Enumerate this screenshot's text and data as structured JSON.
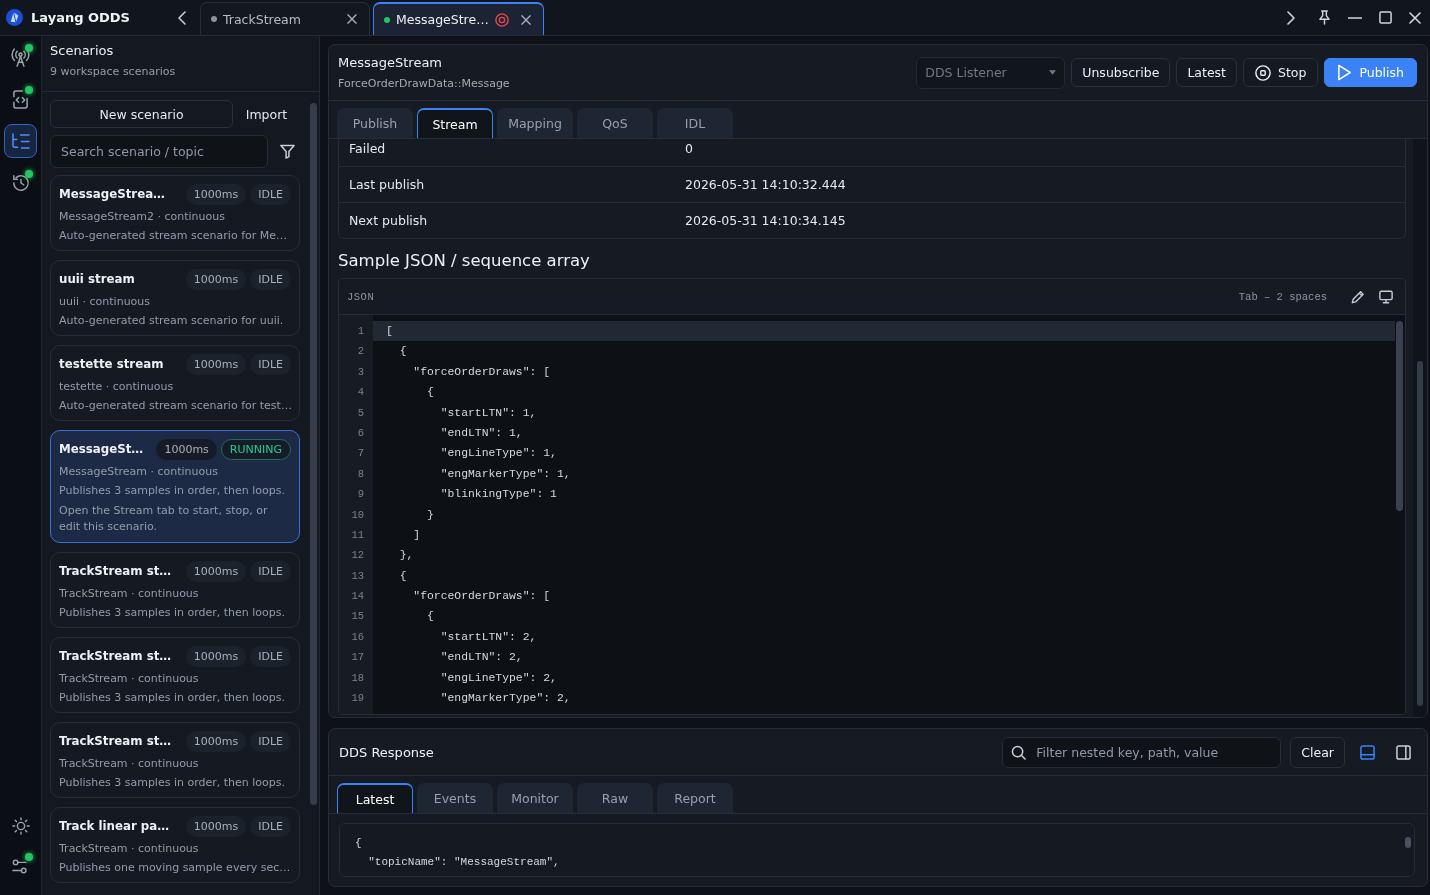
{
  "titlebar": {
    "app_name": "Layang ODDS",
    "tabs": [
      {
        "label": "TrackStream",
        "color": "#8b93a1",
        "running": false,
        "selected": false
      },
      {
        "label": "MessageStre…",
        "color": "#22c55e",
        "running": true,
        "selected": true
      }
    ]
  },
  "rail": {
    "top": [
      {
        "kind": "antenna",
        "selected": false,
        "badge": true
      },
      {
        "kind": "device",
        "selected": false,
        "badge": true
      },
      {
        "kind": "list",
        "selected": true,
        "badge": false
      },
      {
        "kind": "history",
        "selected": false,
        "badge": true
      }
    ],
    "bottom": [
      {
        "kind": "sun",
        "selected": false,
        "badge": false
      },
      {
        "kind": "nodes",
        "selected": false,
        "badge": true
      }
    ]
  },
  "sidebar": {
    "title": "Scenarios",
    "subtitle": "9 workspace scenarios",
    "new_button": "New scenario",
    "import_button": "Import",
    "search": {
      "placeholder": "Search scenario / topic"
    },
    "scenarios": [
      {
        "name": "MessageStrea…",
        "interval": "1000ms",
        "status": "IDLE",
        "running": false,
        "topic": "MessageStream2 · continuous",
        "description": "Auto-generated stream scenario for Me…",
        "selected": false
      },
      {
        "name": "uuii stream",
        "interval": "1000ms",
        "status": "IDLE",
        "running": false,
        "topic": "uuii · continuous",
        "description": "Auto-generated stream scenario for uuii.",
        "selected": false
      },
      {
        "name": "testette stream",
        "interval": "1000ms",
        "status": "IDLE",
        "running": false,
        "topic": "testette · continuous",
        "description": "Auto-generated stream scenario for test…",
        "selected": false
      },
      {
        "name": "MessageSt…",
        "interval": "1000ms",
        "status": "RUNNING",
        "running": true,
        "topic": "MessageStream · continuous",
        "description": "Publishes 3 samples in order, then loops.",
        "note": "Open the Stream tab to start, stop, or edit this scenario.",
        "selected": true
      },
      {
        "name": "TrackStream st…",
        "interval": "1000ms",
        "status": "IDLE",
        "running": false,
        "topic": "TrackStream · continuous",
        "description": "Publishes 3 samples in order, then loops.",
        "selected": false
      },
      {
        "name": "TrackStream st…",
        "interval": "1000ms",
        "status": "IDLE",
        "running": false,
        "topic": "TrackStream · continuous",
        "description": "Publishes 3 samples in order, then loops.",
        "selected": false
      },
      {
        "name": "TrackStream st…",
        "interval": "1000ms",
        "status": "IDLE",
        "running": false,
        "topic": "TrackStream · continuous",
        "description": "Publishes 3 samples in order, then loops.",
        "selected": false
      },
      {
        "name": "Track linear pa…",
        "interval": "1000ms",
        "status": "IDLE",
        "running": false,
        "topic": "TrackStream · continuous",
        "description": "Publishes one moving sample every sec…",
        "selected": false
      }
    ]
  },
  "main": {
    "title": "MessageStream",
    "type_name": "ForceOrderDrawData::Message",
    "listener": {
      "value": "DDS Listener",
      "disabled": true
    },
    "buttons": [
      {
        "label": "Unsubscribe",
        "kind": "plain"
      },
      {
        "label": "Latest",
        "kind": "plain"
      },
      {
        "label": "Stop",
        "kind": "stop"
      },
      {
        "label": "Publish",
        "kind": "primary"
      }
    ],
    "tabs": [
      {
        "label": "Publish",
        "selected": false
      },
      {
        "label": "Stream",
        "selected": true
      },
      {
        "label": "Mapping",
        "selected": false
      },
      {
        "label": "QoS",
        "selected": false
      },
      {
        "label": "IDL",
        "selected": false
      }
    ],
    "stats": [
      {
        "label": "Failed",
        "value": "0"
      },
      {
        "label": "Last publish",
        "value": "2026-05-31 14:10:32.444"
      },
      {
        "label": "Next publish",
        "value": "2026-05-31 14:10:34.145"
      }
    ],
    "sample_title": "Sample JSON / sequence array",
    "editor": {
      "language": "JSON",
      "indent": "Tab – 2 spaces",
      "lines": [
        {
          "number": "1",
          "text": "[",
          "current": true
        },
        {
          "number": "2",
          "text": "  {",
          "current": false
        },
        {
          "number": "3",
          "text": "    \"forceOrderDraws\": [",
          "current": false
        },
        {
          "number": "4",
          "text": "      {",
          "current": false
        },
        {
          "number": "5",
          "text": "        \"startLTN\": 1,",
          "current": false
        },
        {
          "number": "6",
          "text": "        \"endLTN\": 1,",
          "current": false
        },
        {
          "number": "7",
          "text": "        \"engLineType\": 1,",
          "current": false
        },
        {
          "number": "8",
          "text": "        \"engMarkerType\": 1,",
          "current": false
        },
        {
          "number": "9",
          "text": "        \"blinkingType\": 1",
          "current": false
        },
        {
          "number": "10",
          "text": "      }",
          "current": false
        },
        {
          "number": "11",
          "text": "    ]",
          "current": false
        },
        {
          "number": "12",
          "text": "  },",
          "current": false
        },
        {
          "number": "13",
          "text": "  {",
          "current": false
        },
        {
          "number": "14",
          "text": "    \"forceOrderDraws\": [",
          "current": false
        },
        {
          "number": "15",
          "text": "      {",
          "current": false
        },
        {
          "number": "16",
          "text": "        \"startLTN\": 2,",
          "current": false
        },
        {
          "number": "17",
          "text": "        \"endLTN\": 2,",
          "current": false
        },
        {
          "number": "18",
          "text": "        \"engLineType\": 2,",
          "current": false
        },
        {
          "number": "19",
          "text": "        \"engMarkerType\": 2,",
          "current": false
        }
      ]
    }
  },
  "response": {
    "title": "DDS Response",
    "filter": {
      "placeholder": "Filter nested key, path, value"
    },
    "clear_button": "Clear",
    "layouts": [
      {
        "kind": "bottom",
        "selected": true
      },
      {
        "kind": "right",
        "selected": false
      }
    ],
    "tabs": [
      {
        "label": "Latest",
        "selected": true
      },
      {
        "label": "Events",
        "selected": false
      },
      {
        "label": "Monitor",
        "selected": false
      },
      {
        "label": "Raw",
        "selected": false
      },
      {
        "label": "Report",
        "selected": false
      }
    ],
    "lines": [
      "{",
      "  \"topicName\": \"MessageStream\","
    ]
  }
}
